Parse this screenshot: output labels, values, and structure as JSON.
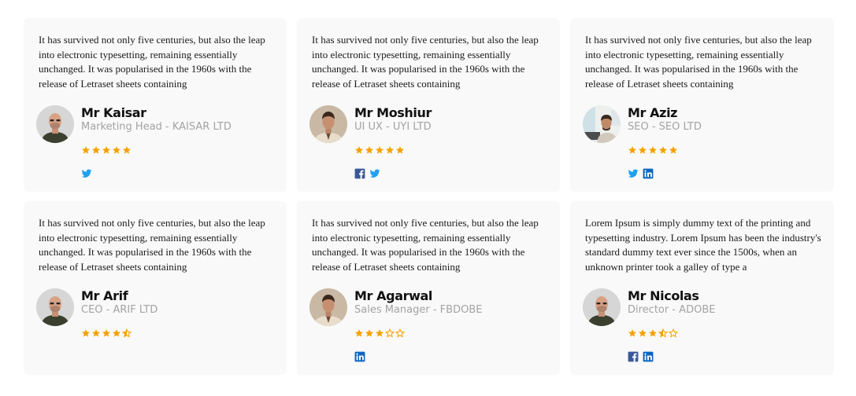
{
  "colors": {
    "card_bg": "#f9f9f9",
    "star": "#f5a100",
    "twitter": "#1da1f2",
    "facebook": "#3b5998",
    "linkedin": "#0a66c2",
    "role_text": "#a3a3a3"
  },
  "testimonials": [
    {
      "quote": "It has survived not only five centuries, but also the leap into electronic typesetting, remaining essentially unchanged. It was popularised in the 1960s with the release of Letraset sheets containing",
      "name": "Mr Kaisar",
      "role": "Marketing Head - KAISAR LTD",
      "avatar": "bald-man",
      "rating": 5,
      "socials": [
        "twitter-icon"
      ]
    },
    {
      "quote": "It has survived not only five centuries, but also the leap into electronic typesetting, remaining essentially unchanged. It was popularised in the 1960s with the release of Letraset sheets containing",
      "name": "Mr Moshiur",
      "role": "UI UX - UYI LTD",
      "avatar": "man-hair",
      "rating": 5,
      "socials": [
        "facebook-icon",
        "twitter-icon"
      ]
    },
    {
      "quote": "It has survived not only five centuries, but also the leap into electronic typesetting, remaining essentially unchanged. It was popularised in the 1960s with the release of Letraset sheets containing",
      "name": "Mr Aziz",
      "role": "SEO - SEO LTD",
      "avatar": "man-office",
      "rating": 5,
      "socials": [
        "twitter-icon",
        "linkedin-icon"
      ]
    },
    {
      "quote": "It has survived not only five centuries, but also the leap into electronic typesetting, remaining essentially unchanged. It was popularised in the 1960s with the release of Letraset sheets containing",
      "name": "Mr Arif",
      "role": "CEO - ARIF LTD",
      "avatar": "bald-man",
      "rating": 4.5,
      "socials": []
    },
    {
      "quote": "It has survived not only five centuries, but also the leap into electronic typesetting, remaining essentially unchanged. It was popularised in the 1960s with the release of Letraset sheets containing",
      "name": "Mr Agarwal",
      "role": "Sales Manager - FBDOBE",
      "avatar": "man-hair",
      "rating": 3,
      "socials": [
        "linkedin-icon"
      ]
    },
    {
      "quote": "Lorem Ipsum is simply dummy text of the printing and typesetting industry. Lorem Ipsum has been the industry's standard dummy text ever since the 1500s, when an unknown printer took a galley of type a",
      "name": "Mr Nicolas",
      "role": "Director - ADOBE",
      "avatar": "bald-man",
      "rating": 3.5,
      "socials": [
        "facebook-icon",
        "linkedin-icon"
      ]
    }
  ]
}
